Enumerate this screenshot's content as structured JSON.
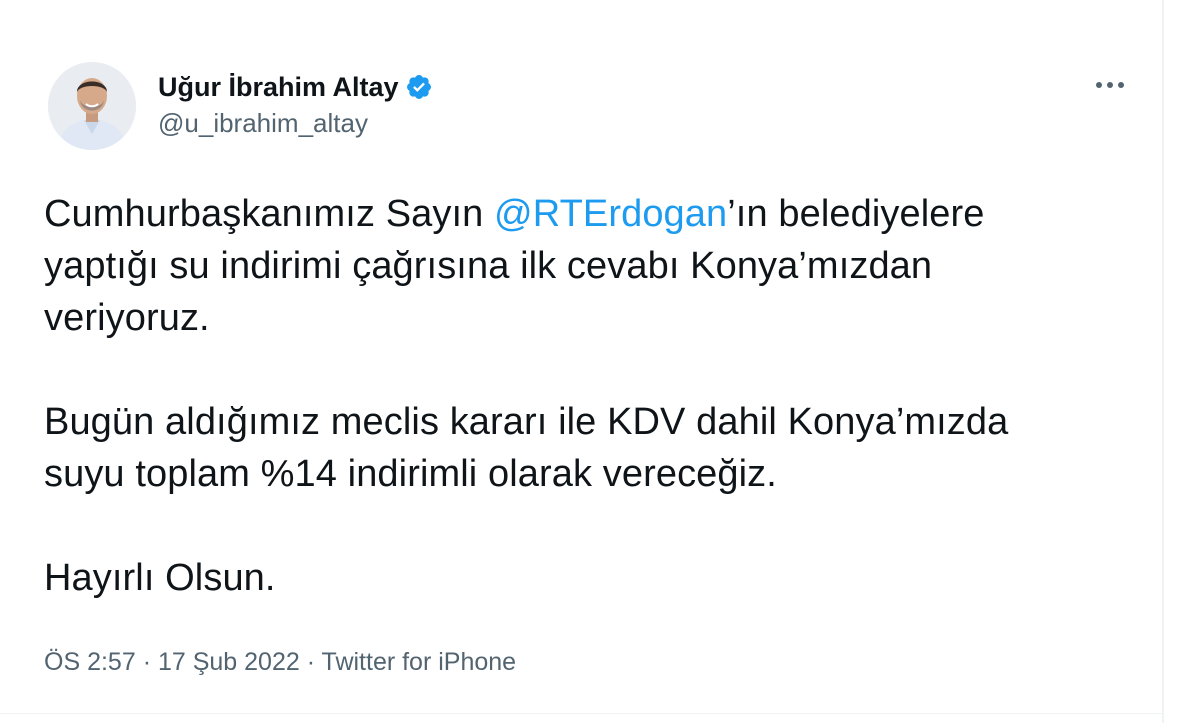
{
  "author": {
    "display_name": "Uğur İbrahim Altay",
    "handle": "@u_ibrahim_altay",
    "verified_icon": "verified-badge-icon",
    "avatar_icon": "profile-photo"
  },
  "tweet": {
    "line1_pre": "Cumhurbaşkanımız Sayın ",
    "mention": "@RTErdogan",
    "line1_post": "’ın belediyelere",
    "line2": "yaptığı su indirimi çağrısına ilk cevabı Konya’mızdan",
    "line3": "veriyoruz.",
    "line4": "Bugün aldığımız meclis kararı ile KDV dahil Konya’mızda",
    "line5": "suyu toplam %14 indirimli olarak vereceğiz.",
    "line6": "Hayırlı Olsun."
  },
  "meta": {
    "time": "ÖS 2:57",
    "separator": "·",
    "date": "17 Şub 2022",
    "source": "Twitter for iPhone"
  },
  "colors": {
    "accent": "#1d9bf0",
    "text": "#0f1419",
    "secondary": "#536471"
  },
  "icons": {
    "more": "more-options-icon"
  }
}
